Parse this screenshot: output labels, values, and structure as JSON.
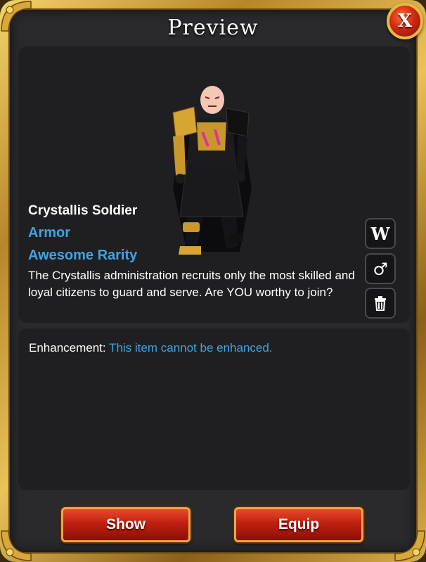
{
  "window": {
    "title": "Preview",
    "close_label": "X"
  },
  "item": {
    "name": "Crystallis Soldier",
    "type": "Armor",
    "rarity": "Awesome Rarity",
    "description": "The Crystallis administration recruits only the most skilled and loyal citizens to guard and serve. Are YOU worthy to join?"
  },
  "side_buttons": [
    {
      "name": "wiki-button",
      "icon": "wiki-icon",
      "label": "W"
    },
    {
      "name": "gender-button",
      "icon": "male-icon",
      "label": "♂"
    },
    {
      "name": "delete-button",
      "icon": "trash-icon",
      "label": ""
    }
  ],
  "enhancement": {
    "label": "Enhancement:",
    "value": "This item cannot be enhanced."
  },
  "actions": {
    "show_label": "Show",
    "equip_label": "Equip"
  },
  "colors": {
    "accent_blue": "#3ea4e4",
    "panel": "#1f1f21",
    "gold": "#e8b845",
    "button_red": "#c02010"
  }
}
